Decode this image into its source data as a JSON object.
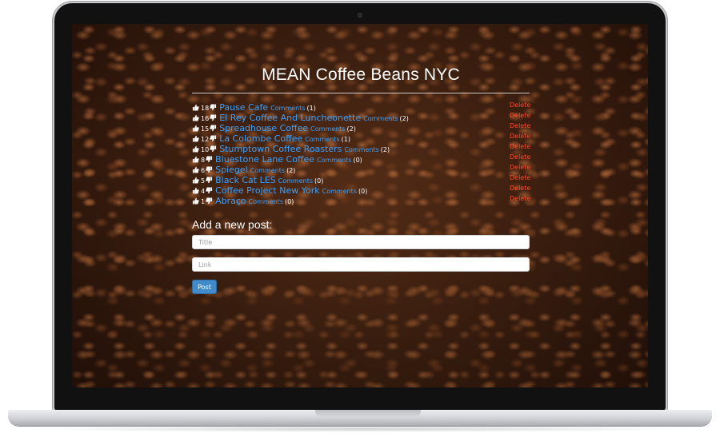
{
  "page": {
    "title": "MEAN Coffee Beans NYC"
  },
  "icons": {
    "upvote": "thumbs-up-icon",
    "downvote": "thumbs-down-icon"
  },
  "colors": {
    "link": "#3aa1ff",
    "delete": "#ff4a2e",
    "button": "#428bca",
    "text": "#ffffff"
  },
  "posts": [
    {
      "upvotes": "18",
      "title": "Pause Cafe",
      "comments_label": "Comments",
      "comment_count": "(1)",
      "delete_label": "Delete"
    },
    {
      "upvotes": "16",
      "title": "El Rey Coffee And Luncheonette",
      "comments_label": "Comments",
      "comment_count": "(2)",
      "delete_label": "Delete"
    },
    {
      "upvotes": "15",
      "title": "Spreadhouse Coffee",
      "comments_label": "Comments",
      "comment_count": "(2)",
      "delete_label": "Delete"
    },
    {
      "upvotes": "12",
      "title": "La Colombe Coffee",
      "comments_label": "Comments",
      "comment_count": "(1)",
      "delete_label": "Delete"
    },
    {
      "upvotes": "10",
      "title": "Stumptown Coffee Roasters",
      "comments_label": "Comments",
      "comment_count": "(2)",
      "delete_label": "Delete"
    },
    {
      "upvotes": "8",
      "title": "Bluestone Lane Coffee",
      "comments_label": "Comments",
      "comment_count": "(0)",
      "delete_label": "Delete"
    },
    {
      "upvotes": "6",
      "title": "Spiegel",
      "comments_label": "Comments",
      "comment_count": "(2)",
      "delete_label": "Delete"
    },
    {
      "upvotes": "5",
      "title": "Black Cat LES",
      "comments_label": "Comments",
      "comment_count": "(0)",
      "delete_label": "Delete"
    },
    {
      "upvotes": "4",
      "title": "Coffee Project New York",
      "comments_label": "Comments",
      "comment_count": "(0)",
      "delete_label": "Delete"
    },
    {
      "upvotes": "1",
      "title": "Abraço",
      "comments_label": "Comments",
      "comment_count": "(0)",
      "delete_label": "Delete"
    }
  ],
  "form": {
    "heading": "Add a new post:",
    "title_placeholder": "Title",
    "title_value": "",
    "link_placeholder": "Link",
    "link_value": "",
    "submit_label": "Post"
  }
}
